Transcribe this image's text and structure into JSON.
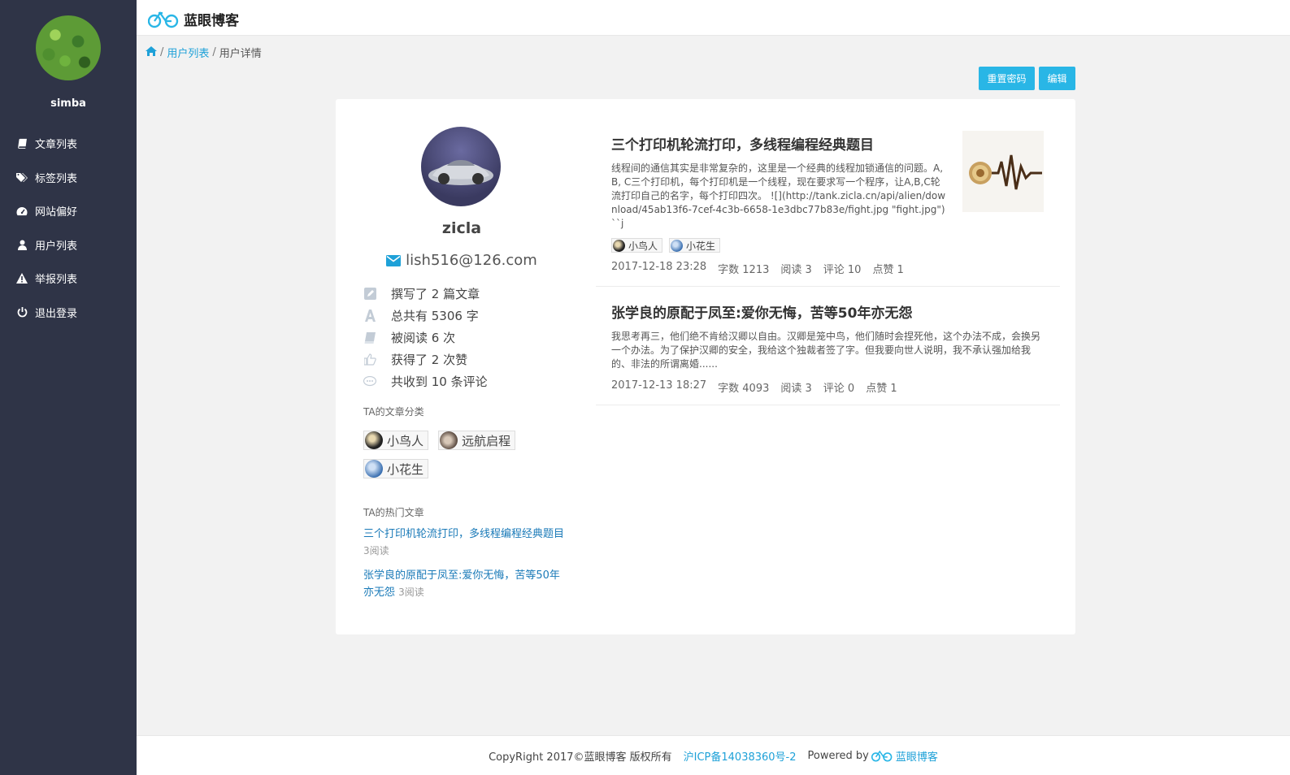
{
  "app": {
    "name": "蓝眼博客",
    "brand_color": "#29b6e6"
  },
  "sidebar": {
    "username": "simba",
    "items": [
      {
        "label": "文章列表",
        "icon": "book-icon"
      },
      {
        "label": "标签列表",
        "icon": "tags-icon"
      },
      {
        "label": "网站偏好",
        "icon": "dashboard-icon"
      },
      {
        "label": "用户列表",
        "icon": "user-icon"
      },
      {
        "label": "举报列表",
        "icon": "warning-icon"
      },
      {
        "label": "退出登录",
        "icon": "power-icon"
      }
    ]
  },
  "breadcrumb": {
    "home_icon": "home-icon",
    "list": "用户列表",
    "current": "用户详情",
    "separator": "/"
  },
  "actions": {
    "reset_password": "重置密码",
    "edit": "编辑"
  },
  "profile": {
    "name": "zicla",
    "email": "lish516@126.com",
    "stats": [
      {
        "text": "撰写了 2 篇文章",
        "icon": "pencil-icon"
      },
      {
        "text": "总共有 5306 字",
        "icon": "font-icon"
      },
      {
        "text": "被阅读 6 次",
        "icon": "book-icon"
      },
      {
        "text": "获得了 2 次赞",
        "icon": "thumbs-up-icon"
      },
      {
        "text": "共收到 10 条评论",
        "icon": "comment-icon"
      }
    ],
    "categories_title": "TA的文章分类",
    "categories": [
      "小鸟人",
      "远航启程",
      "小花生"
    ],
    "hot_title": "TA的热门文章",
    "hot_articles": [
      {
        "title": "三个打印机轮流打印，多线程编程经典题目",
        "reads": "3阅读"
      },
      {
        "title": "张学良的原配于凤至:爱你无悔，苦等50年亦无怨",
        "reads": "3阅读"
      }
    ]
  },
  "articles": [
    {
      "title": "三个打印机轮流打印，多线程编程经典题目",
      "summary": "线程间的通信其实是非常复杂的，这里是一个经典的线程加锁通信的问题。A, B, C三个打印机，每个打印机是一个线程，现在要求写一个程序，让A,B,C轮流打印自己的名字，每个打印四次。 ![](http://tank.zicla.cn/api/alien/download/45ab13f6-7cef-4c3b-6658-1e3dbc77b83e/fight.jpg \"fight.jpg\") ``j",
      "tags": [
        "小鸟人",
        "小花生"
      ],
      "date": "2017-12-18 23:28",
      "words": "字数 1213",
      "reads": "阅读 3",
      "comments": "评论 10",
      "likes": "点赞 1",
      "has_thumb": true
    },
    {
      "title": "张学良的原配于凤至:爱你无悔，苦等50年亦无怨",
      "summary": "我思考再三，他们绝不肯给汉卿以自由。汉卿是笼中鸟，他们随时会捏死他，这个办法不成，会换另一个办法。为了保护汉卿的安全，我给这个独裁者签了字。但我要向世人说明，我不承认强加给我的、非法的所谓离婚......",
      "tags": [],
      "date": "2017-12-13 18:27",
      "words": "字数 4093",
      "reads": "阅读 3",
      "comments": "评论 0",
      "likes": "点赞 1",
      "has_thumb": false
    }
  ],
  "footer": {
    "copyright": "CopyRight 2017©蓝眼博客 版权所有",
    "icp": "沪ICP备14038360号-2",
    "powered_by": "Powered by",
    "powered_name": "蓝眼博客"
  }
}
